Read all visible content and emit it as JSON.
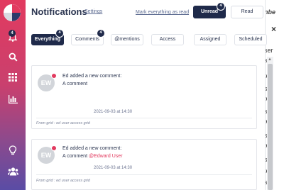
{
  "sidebar": {
    "items": [
      {
        "name": "notifications",
        "icon": "bell-icon",
        "badge": "4"
      },
      {
        "name": "search",
        "icon": "search-icon"
      },
      {
        "name": "apps",
        "icon": "grid-icon"
      },
      {
        "name": "reports",
        "icon": "chart-icon"
      },
      {
        "name": "ideas",
        "icon": "lightbulb-icon"
      },
      {
        "name": "users",
        "icon": "users-icon"
      }
    ],
    "gradient": [
      "#e23a5f",
      "#5a4ca5"
    ]
  },
  "header": {
    "title": "Notifications",
    "settings_label": "Settings",
    "mark_all_read_label": "Mark everything as read",
    "unread_label": "Unread",
    "unread_count": "4",
    "read_label": "Read"
  },
  "filters": [
    {
      "label": "Everything",
      "count": "4",
      "active": true
    },
    {
      "label": "Comments",
      "count": "4",
      "active": false
    },
    {
      "label": "@mentions",
      "active": false
    },
    {
      "label": "Access",
      "active": false
    },
    {
      "label": "Assigned",
      "active": false
    },
    {
      "label": "Scheduled",
      "active": false
    }
  ],
  "notifications": [
    {
      "initials": "EW",
      "line1": "Ed added a new comment:",
      "line2": "A comment",
      "mention": "",
      "date": "2021-09-03 at 14:30",
      "source": "From grid : ed user access grid"
    },
    {
      "initials": "EW",
      "line1": "Ed added a new comment:",
      "line2": "A comment",
      "mention": "@Edward User",
      "date": "2021-09-03 at 14:30",
      "source": "From grid : ed user access grid"
    }
  ],
  "background": {
    "column_header": "nbe",
    "cells": [
      "ser",
      "ser",
      "ser",
      "ser",
      "ser",
      "ser",
      "ser",
      "ser",
      "ser",
      "ser",
      "ter",
      "ter",
      "ter",
      "ter",
      "ter",
      "ter"
    ],
    "close": "×"
  },
  "colors": {
    "accent": "#1f2a4a",
    "mention": "#e23a5f"
  }
}
